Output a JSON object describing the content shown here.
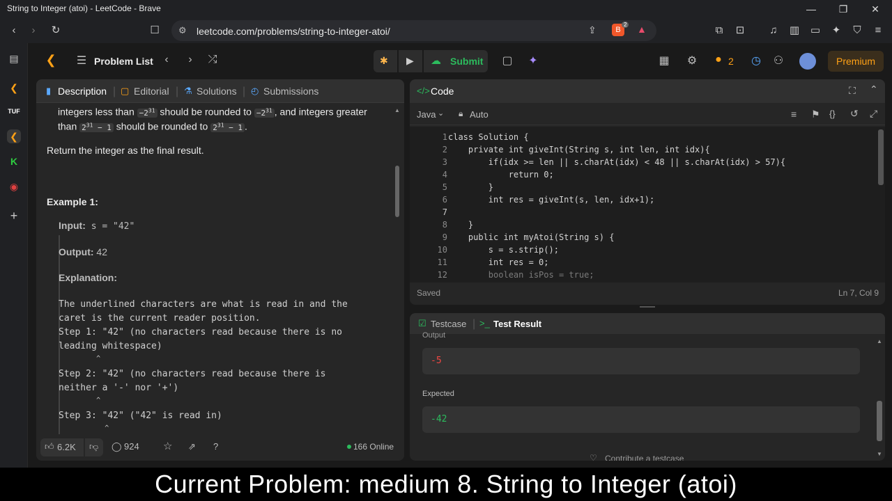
{
  "window": {
    "title": "String to Integer (atoi) - LeetCode - Brave",
    "url": "leetcode.com/problems/string-to-integer-atoi/",
    "brave_badge": "2"
  },
  "nav": {
    "problem_list": "Problem List",
    "submit": "Submit",
    "streak": "2",
    "premium": "Premium"
  },
  "desc_tabs": [
    "Description",
    "Editorial",
    "Solutions",
    "Submissions"
  ],
  "description": {
    "rule_part1": "integers less than",
    "rule_chip1": "−2",
    "rule_sup1": "31",
    "rule_part2": "should be rounded to",
    "rule_chip2": "−2",
    "rule_sup2": "31",
    "rule_part3": ", and integers greater",
    "rule_part4": "than",
    "rule_chip3": "2",
    "rule_sup3": "31",
    "rule_chip3b": " − 1",
    "rule_part5": "should be rounded to",
    "rule_chip4": "2",
    "rule_sup4": "31",
    "rule_chip4b": " − 1",
    "rule_part6": ".",
    "return_text": "Return the integer as the final result.",
    "example_title": "Example 1:",
    "input_label": "Input:",
    "input_value": " s = \"42\"",
    "output_label": "Output:",
    "output_value": " 42",
    "explanation_label": "Explanation:",
    "explanation_lines": [
      "The underlined characters are what is read in and the",
      "caret is the current reader position.",
      "Step 1: \"42\" (no characters read because there is no",
      "leading whitespace)",
      "         ^",
      "Step 2: \"42\" (no characters read because there is",
      "neither a '-' nor '+')",
      "         ^",
      "Step 3: \"42\" (\"42\" is read in)",
      "           ^"
    ]
  },
  "footer": {
    "likes": "6.2K",
    "comments": "924",
    "online": "166 Online"
  },
  "code": {
    "title": "Code",
    "language": "Java",
    "mode": "Auto",
    "status": "Saved",
    "cursor": "Ln 7, Col 9",
    "lines": [
      "class Solution {",
      "    private int giveInt(String s, int len, int idx){",
      "        if(idx >= len || s.charAt(idx) < 48 || s.charAt(idx) > 57){",
      "            return 0;",
      "        }",
      "        int res = giveInt(s, len, idx+1);",
      "",
      "    }",
      "    public int myAtoi(String s) {",
      "        s = s.strip();",
      "        int res = 0;",
      "        boolean isPos = true;"
    ]
  },
  "result": {
    "tab_testcase": "Testcase",
    "tab_result": "Test Result",
    "output_label": "Output",
    "output_value": "-5",
    "expected_label": "Expected",
    "expected_value": "-42",
    "contribute": "Contribute a testcase"
  },
  "caption": "Current Problem: medium 8. String to Integer (atoi)"
}
